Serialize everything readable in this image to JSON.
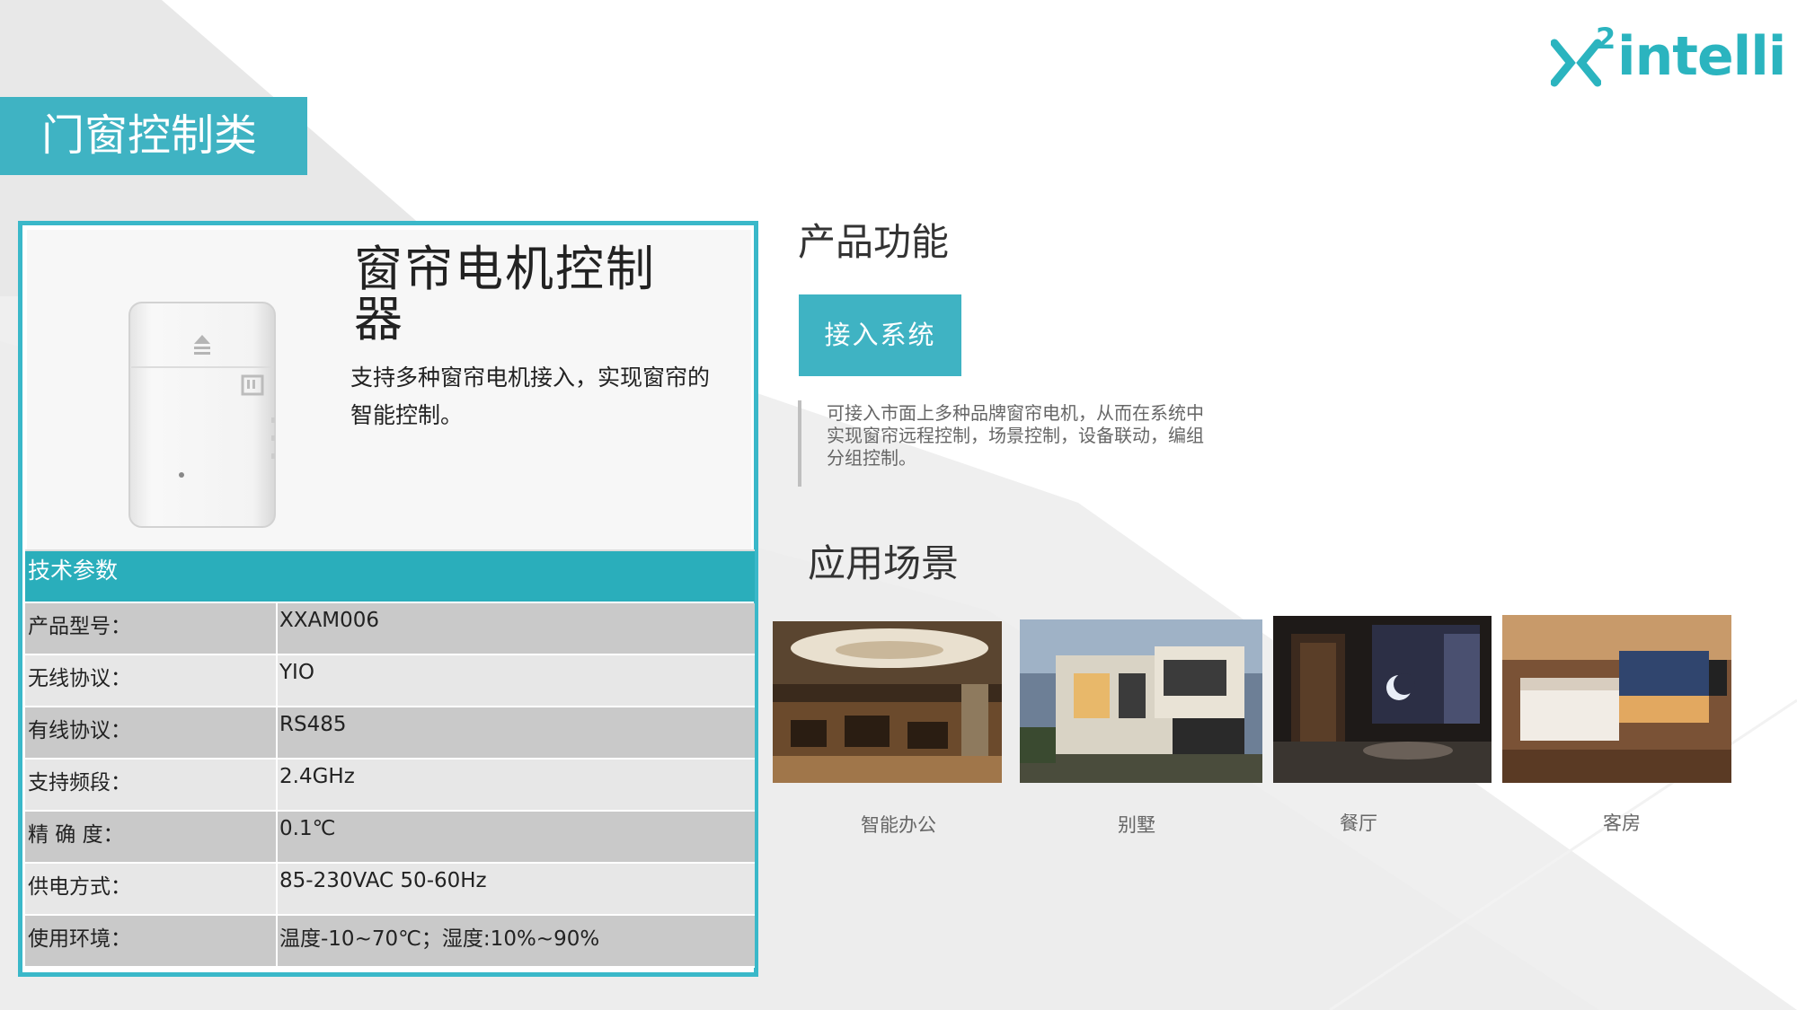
{
  "brand": {
    "logo_text": "intelli",
    "logo_superscript": "2",
    "color": "#2bb4bf"
  },
  "category": {
    "label": "门窗控制类",
    "color": "#3fb3c3"
  },
  "product": {
    "title": "窗帘电机控制器",
    "description": "支持多种窗帘电机接入，实现窗帘的智能控制。"
  },
  "specs": {
    "header": "技术参数",
    "rows": [
      {
        "key": "产品型号：",
        "value": "XXAM006"
      },
      {
        "key": "无线协议：",
        "value": "YIO"
      },
      {
        "key": "有线协议：",
        "value": "RS485"
      },
      {
        "key": "支持频段：",
        "value": "2.4GHz"
      },
      {
        "key": "精 确 度：",
        "value": "0.1℃"
      },
      {
        "key": "供电方式：",
        "value": "85-230VAC 50-60Hz"
      },
      {
        "key": "使用环境：",
        "value": "温度-10~70℃；湿度:10%~90%"
      }
    ]
  },
  "function": {
    "section_title": "产品功能",
    "button_label": "接入系统",
    "description": "可接入市面上多种品牌窗帘电机，从而在系统中实现窗帘远程控制，场景控制，设备联动，编组分组控制。"
  },
  "scenes": {
    "section_title": "应用场景",
    "items": [
      {
        "label": "智能办公"
      },
      {
        "label": "别墅"
      },
      {
        "label": "餐厅"
      },
      {
        "label": "客房"
      }
    ]
  }
}
